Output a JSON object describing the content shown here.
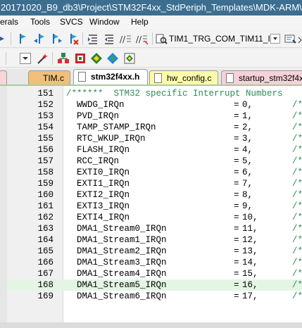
{
  "window": {
    "title": "20171020_B9_db3\\Project\\STM32F4xx_StdPeriph_Templates\\MDK-ARM\\Pro"
  },
  "menu": {
    "items": [
      "erals",
      "Tools",
      "SVCS",
      "Window",
      "Help"
    ]
  },
  "toolbar": {
    "target_combo": "TIM1_TRG_COM_TIM11_I"
  },
  "tabs": [
    {
      "label": "TIM.c",
      "active": false
    },
    {
      "label": "stm32f4xx.h",
      "active": true
    },
    {
      "label": "hw_config.c",
      "active": false
    },
    {
      "label": "startup_stm32f4x",
      "active": false
    }
  ],
  "editor": {
    "highlighted_line": "168",
    "lines": [
      {
        "num": "151",
        "code": "/******  STM32 specific Interrupt Numbers",
        "eq": "",
        "val": "",
        "cmt": ""
      },
      {
        "num": "152",
        "code": "  WWDG_IRQn",
        "eq": "=",
        "val": "0,",
        "cmt": "/*"
      },
      {
        "num": "153",
        "code": "  PVD_IRQn",
        "eq": "=",
        "val": "1,",
        "cmt": "/*"
      },
      {
        "num": "154",
        "code": "  TAMP_STAMP_IRQn",
        "eq": "=",
        "val": "2,",
        "cmt": "/*"
      },
      {
        "num": "155",
        "code": "  RTC_WKUP_IRQn",
        "eq": "=",
        "val": "3,",
        "cmt": "/*"
      },
      {
        "num": "156",
        "code": "  FLASH_IRQn",
        "eq": "=",
        "val": "4,",
        "cmt": "/*"
      },
      {
        "num": "157",
        "code": "  RCC_IRQn",
        "eq": "=",
        "val": "5,",
        "cmt": "/*"
      },
      {
        "num": "158",
        "code": "  EXTI0_IRQn",
        "eq": "=",
        "val": "6,",
        "cmt": "/*"
      },
      {
        "num": "159",
        "code": "  EXTI1_IRQn",
        "eq": "=",
        "val": "7,",
        "cmt": "/*"
      },
      {
        "num": "160",
        "code": "  EXTI2_IRQn",
        "eq": "=",
        "val": "8,",
        "cmt": "/*"
      },
      {
        "num": "161",
        "code": "  EXTI3_IRQn",
        "eq": "=",
        "val": "9,",
        "cmt": "/*"
      },
      {
        "num": "162",
        "code": "  EXTI4_IRQn",
        "eq": "=",
        "val": "10,",
        "cmt": "/*"
      },
      {
        "num": "163",
        "code": "  DMA1_Stream0_IRQn",
        "eq": "=",
        "val": "11,",
        "cmt": "/*"
      },
      {
        "num": "164",
        "code": "  DMA1_Stream1_IRQn",
        "eq": "=",
        "val": "12,",
        "cmt": "/*"
      },
      {
        "num": "165",
        "code": "  DMA1_Stream2_IRQn",
        "eq": "=",
        "val": "13,",
        "cmt": "/*"
      },
      {
        "num": "166",
        "code": "  DMA1_Stream3_IRQn",
        "eq": "=",
        "val": "14,",
        "cmt": "/*"
      },
      {
        "num": "167",
        "code": "  DMA1_Stream4_IRQn",
        "eq": "=",
        "val": "15,",
        "cmt": "/*"
      },
      {
        "num": "168",
        "code": "  DMA1_Stream5_IRQn",
        "eq": "=",
        "val": "16,",
        "cmt": "/*"
      },
      {
        "num": "169",
        "code": "  DMA1_Stream6_IRQn",
        "eq": "=",
        "val": "17,",
        "cmt": "/*"
      }
    ]
  }
}
